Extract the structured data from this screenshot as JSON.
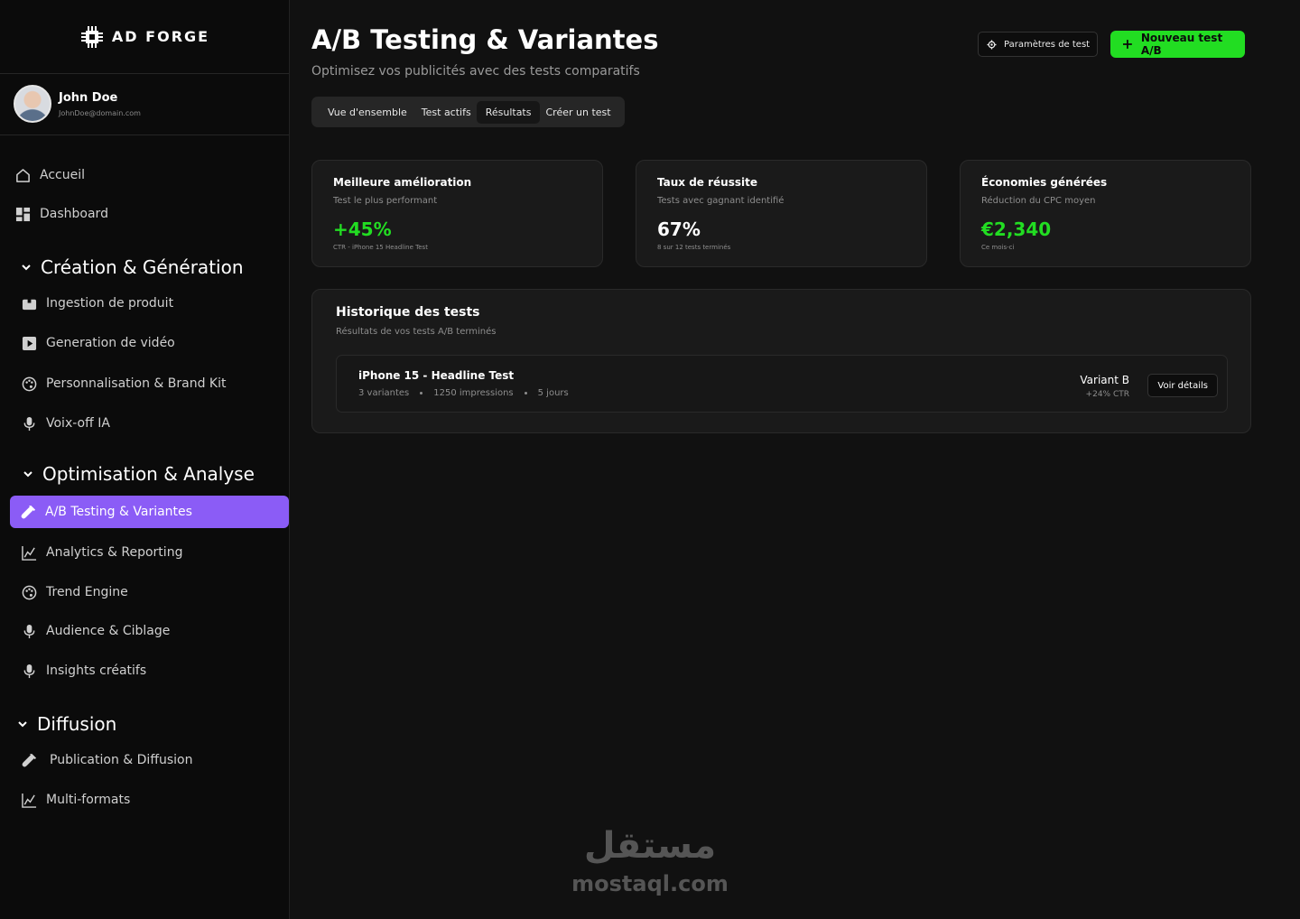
{
  "brand": {
    "name": "AD FORGE",
    "accent": "#8b5cf6",
    "green": "#22dd22"
  },
  "user": {
    "name": "John Doe",
    "email": "JohnDoe@domain.com"
  },
  "nav": {
    "top": [
      {
        "label": "Accueil",
        "icon": "home-icon"
      },
      {
        "label": "Dashboard",
        "icon": "dashboard-icon"
      }
    ],
    "sections": [
      {
        "title": "Création & Génération",
        "items": [
          {
            "label": "Ingestion de produit",
            "icon": "box-icon"
          },
          {
            "label": "Generation de vidéo",
            "icon": "video-icon"
          },
          {
            "label": "Personnalisation & Brand Kit",
            "icon": "palette-icon"
          },
          {
            "label": "Voix-off IA",
            "icon": "mic-icon"
          }
        ]
      },
      {
        "title": "Optimisation & Analyse",
        "items": [
          {
            "label": "A/B Testing & Variantes",
            "icon": "test-tube-icon",
            "active": true
          },
          {
            "label": "Analytics & Reporting",
            "icon": "chart-icon"
          },
          {
            "label": "Trend Engine",
            "icon": "palette-icon"
          },
          {
            "label": "Audience & Ciblage",
            "icon": "mic-icon"
          },
          {
            "label": "Insights créatifs",
            "icon": "mic-icon"
          }
        ]
      },
      {
        "title": "Diffusion",
        "items": [
          {
            "label": "Publication & Diffusion",
            "icon": "test-tube-icon"
          },
          {
            "label": "Multi-formats",
            "icon": "chart-icon"
          }
        ]
      }
    ]
  },
  "header": {
    "title": "A/B Testing & Variantes",
    "subtitle": "Optimisez vos publicités avec des tests comparatifs",
    "settings_button": "Paramètres de test",
    "new_button": "Nouveau test A/B"
  },
  "tabs": [
    {
      "label": "Vue d'ensemble"
    },
    {
      "label": "Test actifs"
    },
    {
      "label": "Résultats",
      "active": true
    },
    {
      "label": "Créer un test"
    }
  ],
  "stats": [
    {
      "title": "Meilleure amélioration",
      "subtitle": "Test le plus performant",
      "value": "+45%",
      "note": "CTR - iPhone 15 Headline Test",
      "highlight": true
    },
    {
      "title": "Taux de réussite",
      "subtitle": "Tests avec gagnant identifié",
      "value": "67%",
      "note": "8 sur 12 tests terminés",
      "highlight": false
    },
    {
      "title": "Économies générées",
      "subtitle": "Réduction du CPC moyen",
      "value": "€2,340",
      "note": "Ce mois-ci",
      "highlight": true
    }
  ],
  "history": {
    "title": "Historique des tests",
    "subtitle": "Résultats de vos tests A/B terminés",
    "rows": [
      {
        "name": "iPhone 15 - Headline Test",
        "variants": "3 variantes",
        "impressions": "1250 impressions",
        "duration": "5 jours",
        "winner": "Variant B",
        "ctr": "+24% CTR",
        "action": "Voir détails"
      }
    ]
  },
  "watermark": {
    "arabic": "مستقل",
    "latin": "mostaql.com"
  }
}
